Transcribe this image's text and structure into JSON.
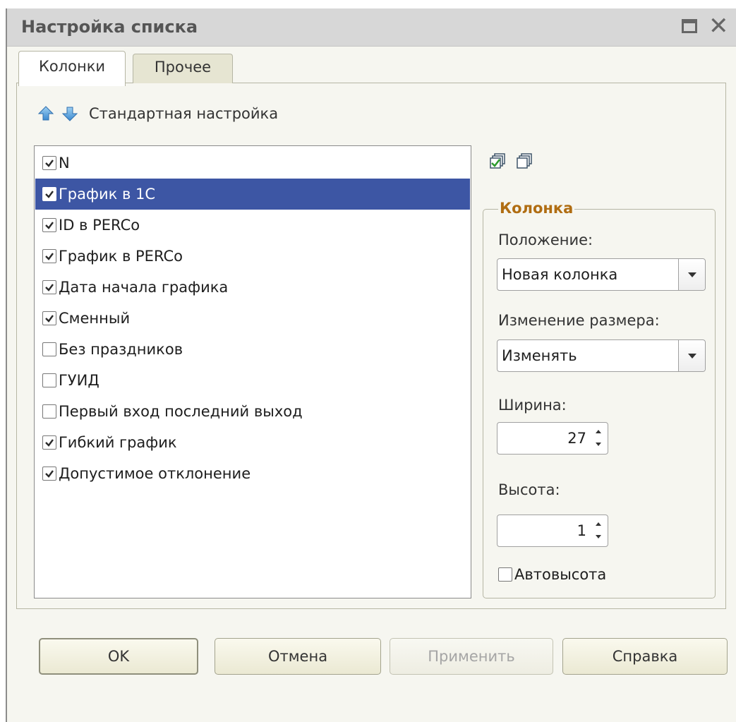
{
  "window": {
    "title": "Настройка списка",
    "controls": [
      "maximize-icon",
      "close-icon"
    ]
  },
  "tabs": [
    {
      "label": "Колонки",
      "active": true
    },
    {
      "label": "Прочее",
      "active": false
    }
  ],
  "toolbar": {
    "move_up_icon": "arrow-up-icon",
    "move_down_icon": "arrow-down-icon",
    "standard_settings_label": "Стандартная настройка"
  },
  "columns_list": [
    {
      "label": "N",
      "checked": true,
      "selected": false
    },
    {
      "label": "График в 1С",
      "checked": true,
      "selected": true
    },
    {
      "label": "ID в PERCo",
      "checked": true,
      "selected": false
    },
    {
      "label": "График в PERCo",
      "checked": true,
      "selected": false
    },
    {
      "label": "Дата начала графика",
      "checked": true,
      "selected": false
    },
    {
      "label": "Сменный",
      "checked": true,
      "selected": false
    },
    {
      "label": "Без праздников",
      "checked": false,
      "selected": false
    },
    {
      "label": "ГУИД",
      "checked": false,
      "selected": false
    },
    {
      "label": "Первый вход последний выход",
      "checked": false,
      "selected": false
    },
    {
      "label": "Гибкий график",
      "checked": true,
      "selected": false
    },
    {
      "label": "Допустимое отклонение",
      "checked": true,
      "selected": false
    }
  ],
  "column_group": {
    "title": "Колонка",
    "position_label": "Положение:",
    "position_value": "Новая колонка",
    "resize_label": "Изменение размера:",
    "resize_value": "Изменять",
    "width_label": "Ширина:",
    "width_value": "27",
    "height_label": "Высота:",
    "height_value": "1",
    "autoheight_label": "Автовысота",
    "autoheight_checked": false
  },
  "buttons": {
    "ok": "OK",
    "cancel": "Отмена",
    "apply": "Применить",
    "help": "Справка"
  },
  "colors": {
    "selection": "#3d56a4",
    "group_title": "#b06d12",
    "background": "#f6f6f0"
  }
}
